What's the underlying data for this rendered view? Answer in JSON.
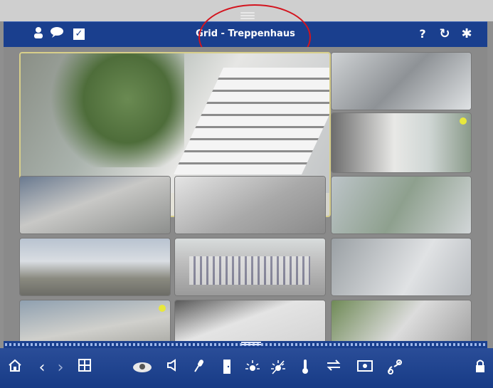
{
  "header": {
    "title": "Grid - Treppenhaus",
    "left_icons": [
      "user-icon",
      "chat-icon",
      "checkbox-icon"
    ],
    "right_icons": [
      "help-icon",
      "refresh-icon",
      "settings-gear-icon"
    ],
    "help_glyph": "?",
    "refresh_glyph": "↻",
    "gear_glyph": "✱",
    "check_glyph": "✓"
  },
  "colors": {
    "header_bg": "#1a3f8e",
    "toolbar_bg": "#1a3f8e",
    "highlight_ring": "#d3141e",
    "active_border": "#d8cf8a",
    "status_dot": "#e8e83c"
  },
  "grid": {
    "layout": "3x5",
    "active_camera": "Treppenhaus",
    "overlay_controls": [
      "zoom-in-icon",
      "image-icon",
      "record-icon",
      "phone-accept-icon",
      "phone-hangup-icon",
      "door-icon",
      "light-icon",
      "temperature-icon",
      "thermometer-icon",
      "intercom-icon"
    ],
    "zoom_glyph": "+"
  },
  "toolbar": {
    "icons": [
      "home-icon",
      "back-arrow-icon",
      "forward-arrow-icon",
      "layout-icon",
      "fisheye-icon",
      "speaker-icon",
      "microphone-icon",
      "door-icon",
      "light-icon",
      "light-off-icon",
      "thermometer-icon",
      "transfer-icon",
      "snapshot-icon",
      "link-icon",
      "lock-icon"
    ],
    "back_glyph": "‹",
    "forward_glyph": "›"
  }
}
